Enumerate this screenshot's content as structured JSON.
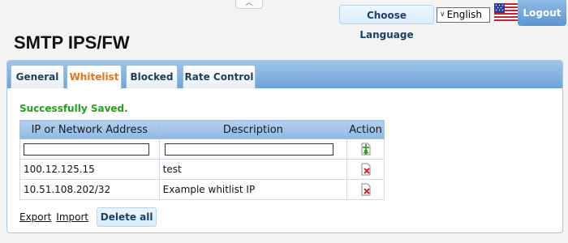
{
  "header": {
    "collapse_icon": "chevron-up-icon",
    "language_button_label": "Choose Language",
    "language_selected": "English",
    "flag_icon": "us-flag-icon",
    "logout_label": "Logout"
  },
  "page": {
    "title": "SMTP IPS/FW"
  },
  "tabs": [
    {
      "label": "General",
      "active": false
    },
    {
      "label": "Whitelist",
      "active": true
    },
    {
      "label": "Blocked",
      "active": false
    },
    {
      "label": "Rate Control",
      "active": false
    }
  ],
  "status": {
    "message": "Successfully Saved.",
    "color": "#22a01c"
  },
  "table": {
    "columns": [
      "IP or Network Address",
      "Description",
      "Action"
    ],
    "new_row": {
      "ip_value": "",
      "description_value": "",
      "action_icon": "add-icon"
    },
    "rows": [
      {
        "ip": "100.12.125.15",
        "description": "test",
        "action_icon": "delete-icon"
      },
      {
        "ip": "10.51.108.202/32",
        "description": "Example whitlist IP",
        "action_icon": "delete-icon"
      }
    ]
  },
  "footer": {
    "export_label": "Export",
    "import_label": "Import",
    "delete_all_label": "Delete all"
  },
  "colors": {
    "accent_tab": "#e2751c",
    "tab_strip": "#7aaade",
    "button_bg": "#d9ebfb"
  }
}
